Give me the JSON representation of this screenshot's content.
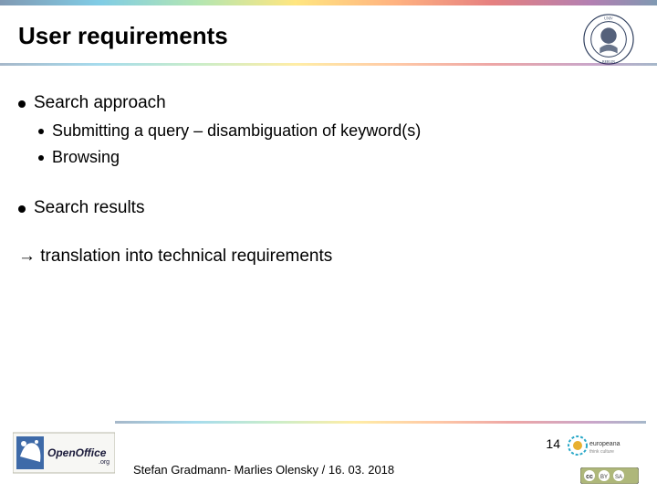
{
  "title": "User requirements",
  "bullets": {
    "l1a": "Search approach",
    "l2a": "Submitting a query – disambiguation of keyword(s)",
    "l2b": "Browsing",
    "l1b": "Search results",
    "arrow": "→ translation into technical requirements"
  },
  "footer": {
    "credit": "Stefan Gradmann- Marlies Olensky / 16. 03. 2018",
    "slide_number": "14"
  },
  "icons": {
    "seal": "university-seal",
    "openoffice": "openoffice-logo",
    "europeana": "europeana-logo",
    "cc": "creative-commons-badge"
  }
}
